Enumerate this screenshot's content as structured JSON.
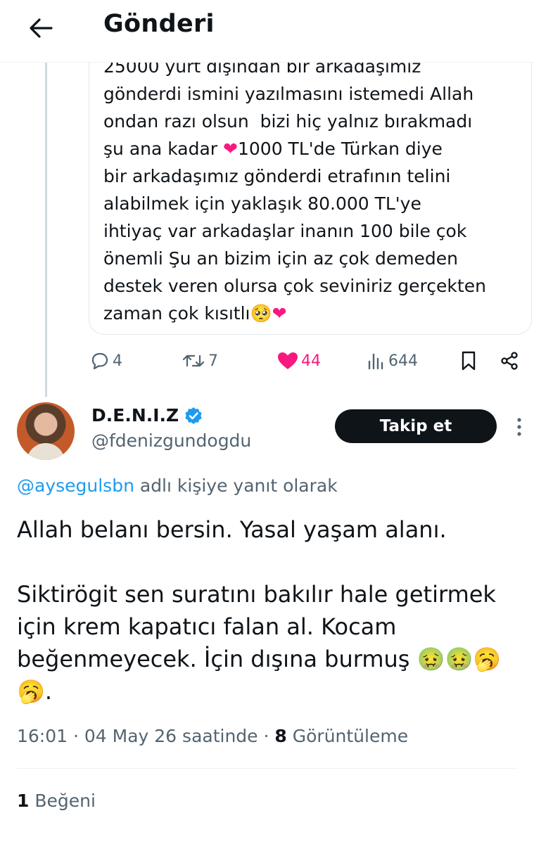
{
  "header": {
    "title": "Gönderi",
    "back_icon": "arrow-left-icon"
  },
  "quoted_tweet": {
    "text_top": "25000 yurt dışından bir arkadaşımız\ngönderdi ismini yazılmasını istemedi Allah\nondan razı olsun  bizi hiç yalnız bırakmadı\nşu ana kadar ",
    "text_heart": "❤",
    "text_mid": "1000 TL'de Türkan diye\nbir arkadaşımız gönderdi etrafının telini\nalabilmek için yaklaşık 80.000 TL'ye\nihtiyaç var arkadaşlar inanın 100 bile çok\nönemli Şu an bizim için az çok demeden\ndestek veren olursa çok seviniriz gerçekten\nzaman çok kısıtlı",
    "text_end": "🥺",
    "text_end_heart": "❤"
  },
  "actions": {
    "replies": "4",
    "reposts": "7",
    "likes": "44",
    "views": "644",
    "like_color": "#f91880"
  },
  "author": {
    "display_name": "D.E.N.I.Z",
    "handle": "@fdenizgundogdu",
    "verified_color": "#1d9bf0",
    "follow_label": "Takip et"
  },
  "reply_to": {
    "handle": "@aysegulsbn",
    "suffix": " adlı kişiye yanıt olarak"
  },
  "tweet": {
    "text": "Allah belanı bersin. Yasal yaşam alanı.\n\nSiktirögit sen suratını bakılır hale getirmek için krem kapatıcı falan al. Kocam beğenmeyecek. İçin dışına burmuş 🤢🤢🥱\n🥱."
  },
  "meta": {
    "time": "16:01",
    "sep1": " · ",
    "date": "04 May 26 saatinde",
    "sep2": " · ",
    "views_count": "8",
    "views_label": " Görüntüleme"
  },
  "engagement": {
    "likes_count": "1",
    "likes_label": " Beğeni"
  },
  "colors": {
    "accent": "#1d9bf0",
    "text": "#0f1419",
    "secondary": "#536471",
    "button_bg": "#0f1419"
  }
}
